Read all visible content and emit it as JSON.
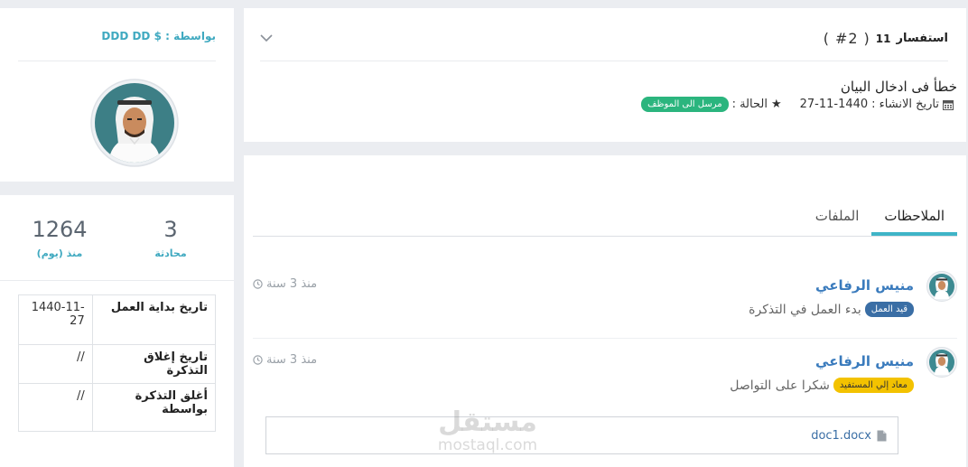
{
  "ticket": {
    "word": "استفسار",
    "number": "11",
    "hash_open": "(",
    "hash": "#2",
    "hash_close": ")",
    "subject": "خطأ فى ادخال البيان",
    "created_label": "تاريخ الانشاء :",
    "created_value": "27-11-1440",
    "status_label": "الحالة :",
    "status_badge": "مرسل الى الموظف",
    "colors": {
      "status": "#2bb57e"
    }
  },
  "tabs": [
    {
      "label": "الملاحظات",
      "active": true
    },
    {
      "label": "الملفات",
      "active": false
    }
  ],
  "notes": [
    {
      "author": "منيس الرفاعي",
      "time": "منذ 3 سنة",
      "badge": "قيد العمل",
      "badge_color": "#3a6ea5",
      "text": "بدء العمل في التذكرة"
    },
    {
      "author": "منيس الرفاعي",
      "time": "منذ 3 سنة",
      "badge": "معاد إلي المستفيد",
      "badge_color": "#f3c200",
      "text": "شكرا على التواصل"
    }
  ],
  "attachment": {
    "name": "doc1.docx",
    "icon": "file-icon"
  },
  "watermark": {
    "brand": "مستقل",
    "domain": "mostaql.com"
  },
  "profile": {
    "by_label": "بواسطة :",
    "by_value": "DDD DD $"
  },
  "stats": [
    {
      "value": "3",
      "label": "محادثة"
    },
    {
      "value": "1264",
      "label": "منذ (يوم)"
    }
  ],
  "info_rows": [
    {
      "label": "تاريخ بداية العمل",
      "value": "1440-11-27"
    },
    {
      "label": "تاريخ إغلاق التذكرة",
      "value": "//"
    },
    {
      "label": "أغلق التذكرة بواسطة",
      "value": "//"
    }
  ],
  "colors": {
    "accent": "#3fb4c7",
    "link": "#3a7bbd",
    "page_bg": "#ebedf1"
  }
}
